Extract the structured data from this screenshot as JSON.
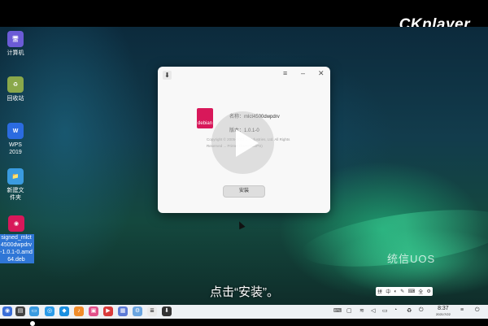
{
  "brand": "CKplayer",
  "desktop": {
    "icons": [
      {
        "label": "计算机",
        "icon": "computer-icon",
        "color": "#6b5bd6"
      },
      {
        "label": "回收站",
        "icon": "trash-icon",
        "color": "#8aa84a"
      },
      {
        "label": "WPS\n2019",
        "icon": "wps-icon",
        "color": "#2b6be0"
      },
      {
        "label": "新建文\n件夹",
        "icon": "folder-icon",
        "color": "#3a9be0"
      },
      {
        "label": "signed_mlct\n4500dwpdrv\n-1.0.1-0.amd\n64.deb",
        "icon": "deb-package-icon",
        "color": "#d8185a"
      }
    ],
    "watermark": "统信UOS"
  },
  "installer": {
    "name_label": "名称：",
    "name_value": "mlct4500dwpdrv",
    "version_label": "版本：",
    "version_value": "1.0.1-0",
    "copyright": "Copyright © 2005-2021 ... Industries, Ltd. All Rights Reserved ... Printer Driver (CUPS)",
    "install_label": "安装",
    "min_label": "–",
    "close_label": "✕",
    "menu_label": "≡"
  },
  "subtitle": "点击“安装”。",
  "ime": [
    "拼",
    "中",
    "◐",
    "✎",
    "⌨",
    "全",
    "⚙"
  ],
  "clock": {
    "time": "8:37",
    "date": "2021/7/22"
  },
  "accent": "#2f76d6"
}
